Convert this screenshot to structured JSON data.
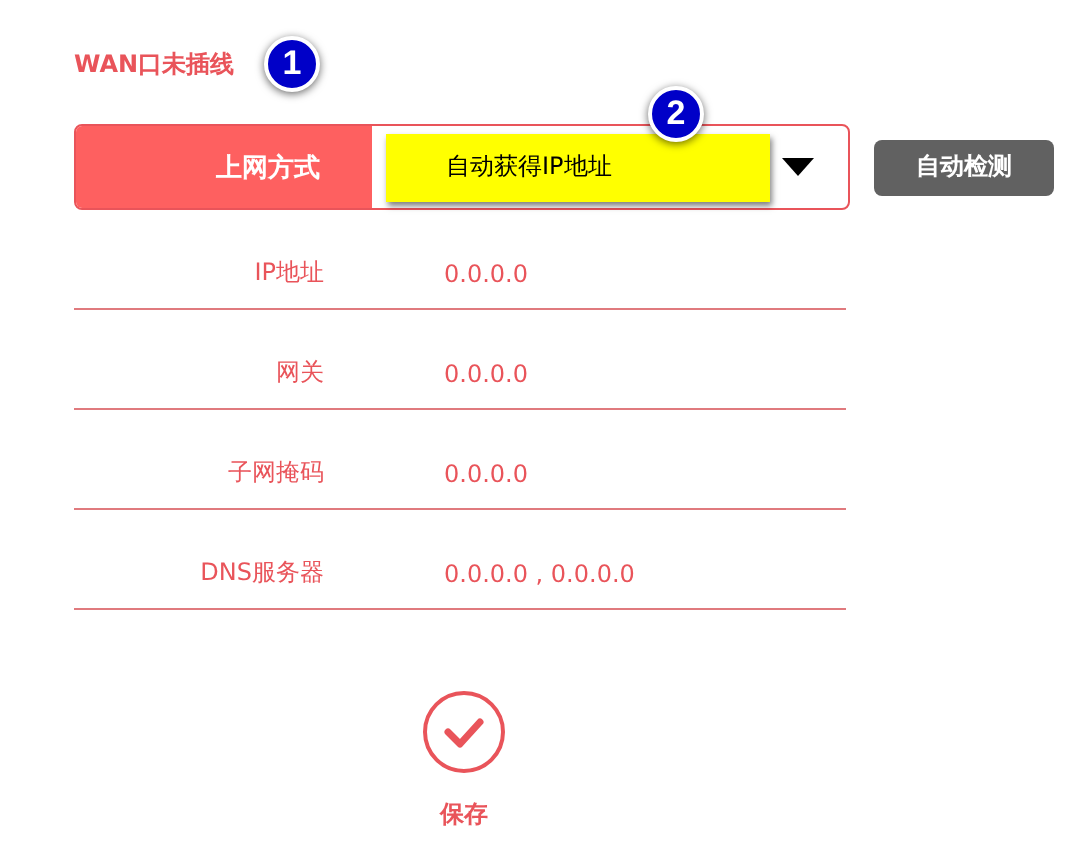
{
  "status_title": "WAN口未插线",
  "markers": [
    {
      "label": "1"
    },
    {
      "label": "2"
    }
  ],
  "connection": {
    "label": "上网方式",
    "value": "自动获得IP地址",
    "detect_button": "自动检测"
  },
  "fields": [
    {
      "label": "IP地址",
      "value": "0.0.0.0"
    },
    {
      "label": "网关",
      "value": "0.0.0.0"
    },
    {
      "label": "子网掩码",
      "value": "0.0.0.0"
    },
    {
      "label": "DNS服务器",
      "value": "0.0.0.0 , 0.0.0.0"
    }
  ],
  "save_button": "保存"
}
